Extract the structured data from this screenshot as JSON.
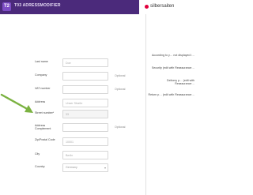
{
  "header": {
    "logo_letter": "T2",
    "title": "T03 ADRESSMODIFIER",
    "brand": "silbersaiten",
    "colors": {
      "bar": "#4b2a7b",
      "brand_mark": "#e1003c"
    }
  },
  "form": {
    "fields": [
      {
        "label": "Last name",
        "value": "Doe",
        "optional": ""
      },
      {
        "label": "Company",
        "value": "",
        "optional": "Optional"
      },
      {
        "label": "VAT number",
        "value": "",
        "optional": "Optional"
      },
      {
        "label": "Address",
        "value": "Unser Straße",
        "optional": ""
      },
      {
        "label": "Street number*",
        "value": "33",
        "optional": ""
      },
      {
        "label": "Address Complement",
        "value": "",
        "optional": "Optional"
      },
      {
        "label": "Zip/Postal Code",
        "value": "10001",
        "optional": ""
      },
      {
        "label": "City",
        "value": "Berlin",
        "optional": ""
      },
      {
        "label": "Country",
        "value": "Germany",
        "optional": ""
      }
    ]
  },
  "sidebar": {
    "items": [
      {
        "text": "According to y… not displayed i…"
      },
      {
        "text": "Security (edit with Reassurance…"
      },
      {
        "text": "Delivery p… (edit with Reassurance…"
      },
      {
        "text": "Return p… (edit with Reassurance…"
      }
    ]
  },
  "annotation": {
    "arrow_color": "#7bb241"
  }
}
